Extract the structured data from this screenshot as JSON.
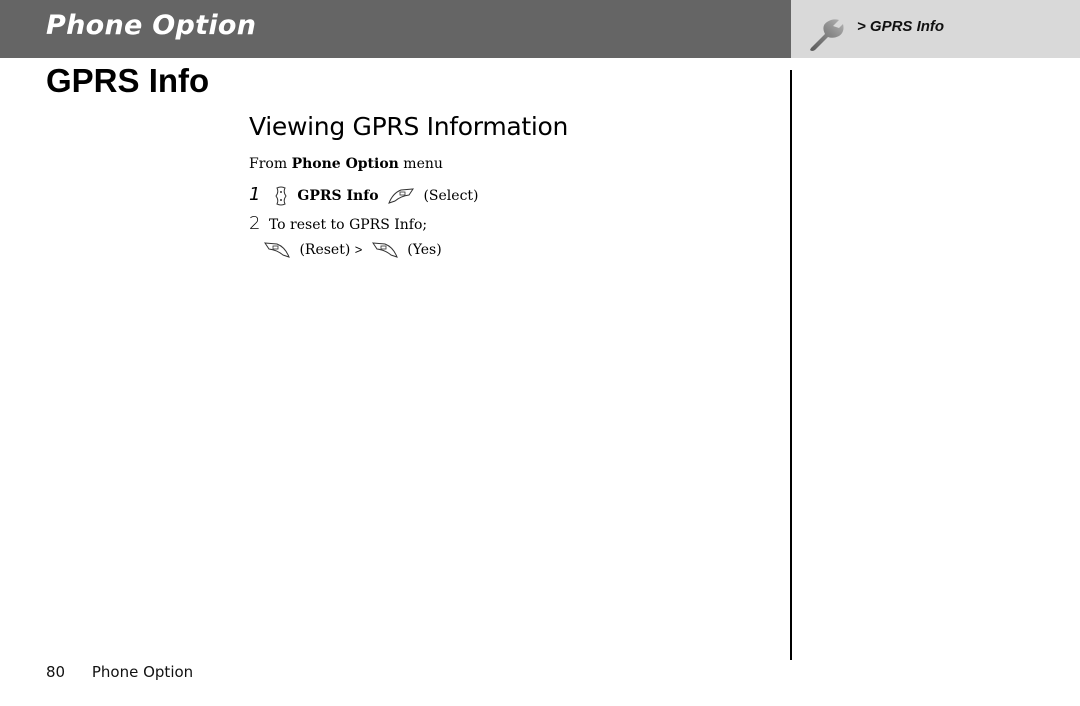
{
  "header": {
    "section_title": "Phone Option",
    "breadcrumb": "> GPRS Info",
    "icon": "wrench-icon"
  },
  "page": {
    "title": "GPRS Info",
    "subtitle": "Viewing GPRS Information"
  },
  "instructions": {
    "from_prefix": "From ",
    "from_menu": "Phone Option",
    "from_suffix": " menu",
    "step1": {
      "number": "1",
      "nav_icon": "navigation-key-icon",
      "item": "GPRS Info",
      "key_icon": "left-soft-key-icon",
      "action": "(Select)"
    },
    "step2": {
      "number": "2",
      "text": "To reset to GPRS Info;",
      "key1_icon": "right-soft-key-icon",
      "action1": "(Reset)",
      "separator": ">",
      "key2_icon": "right-soft-key-icon",
      "action2": "(Yes)"
    }
  },
  "footer": {
    "page_number": "80",
    "section": "Phone Option"
  }
}
